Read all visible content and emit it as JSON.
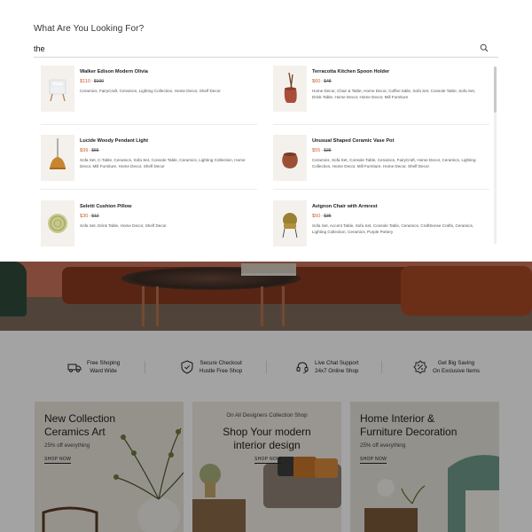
{
  "search": {
    "heading": "What Are You Looking For?",
    "value": "the",
    "icon": "search-icon"
  },
  "results": [
    {
      "title": "Walker Edison Modern Olivia",
      "price": "$110",
      "old": "$100",
      "cats": "Ceramics, FairyCraft, Ceramics, Lighting Collection, Home Decor, Shelf Decor",
      "thumb": "nightstand-thumb"
    },
    {
      "title": "Terracotta Kitchen Spoon Holder",
      "price": "$60",
      "old": "$48",
      "cats": "Home Decor, Chair & Table, Home Decor, Coffee table, Sofa Set, Console Table, Sofa Set, Drink Table, Home Decor, Home Decor, Mill Furniture",
      "thumb": "spoon-holder-thumb"
    },
    {
      "title": "Lucide Woody Pendant Light",
      "price": "$99",
      "old": "$55",
      "cats": "Sofa Set, C-Table, Ceramics, Sofa Set, Console Table, Ceramics, Lighting Collection, Home Decor, Mill Furniture, Home Decor, Shelf Decor",
      "thumb": "pendant-light-thumb"
    },
    {
      "title": "Unusual Shaped Ceramic Vase Pot",
      "price": "$55",
      "old": "$35",
      "cats": "Ceramics, Sofa Set, Console Table, Ceramics, FairyCraft, Home Decor, Ceramics, Lighting Collection, Home Decor, Mill Furniture, Home Decor, Shelf Decor",
      "thumb": "vase-pot-thumb"
    },
    {
      "title": "Seletti Cushion Pillow",
      "price": "$30",
      "old": "$12",
      "cats": "Sofa Set, Drink Table, Home Decor, Shelf Decor",
      "thumb": "cushion-thumb"
    },
    {
      "title": "Avignon Chair with Armrest",
      "price": "$50",
      "old": "$35",
      "cats": "Sofa Set, Accent Table, Sofa Set, Console Table, Ceramics, CraftSense Crafts, Ceramics, Lighting Collection, Ceramics, Purple Pottery",
      "thumb": "armchair-thumb"
    }
  ],
  "price_sep": "-",
  "features": [
    {
      "line1": "Free Shoping",
      "line2": "Ward Wide",
      "icon": "truck-icon"
    },
    {
      "line1": "Secure Checkout",
      "line2": "Hustle Free Shop",
      "icon": "shield-check-icon"
    },
    {
      "line1": "Live Chat Support",
      "line2": "24x7 Online Shop",
      "icon": "headset-icon"
    },
    {
      "line1": "Get Big Saving",
      "line2": "On Exclusive Items",
      "icon": "discount-badge-icon"
    }
  ],
  "cards": [
    {
      "title1": "New Collection",
      "title2": "Ceramics Art",
      "sub": "25% off everything",
      "link": "SHOP NOW"
    },
    {
      "pre": "On All Designers Collection Shop",
      "title1": "Shop Your modern",
      "title2": "interior design",
      "link": "SHOP NOW"
    },
    {
      "title1": "Home Interior &",
      "title2": "Furniture Decoration",
      "sub": "25% off everything",
      "link": "SHOP NOW"
    }
  ],
  "colors": {
    "price": "#c8612e",
    "overlay": "rgba(0,0,0,0.36)"
  }
}
